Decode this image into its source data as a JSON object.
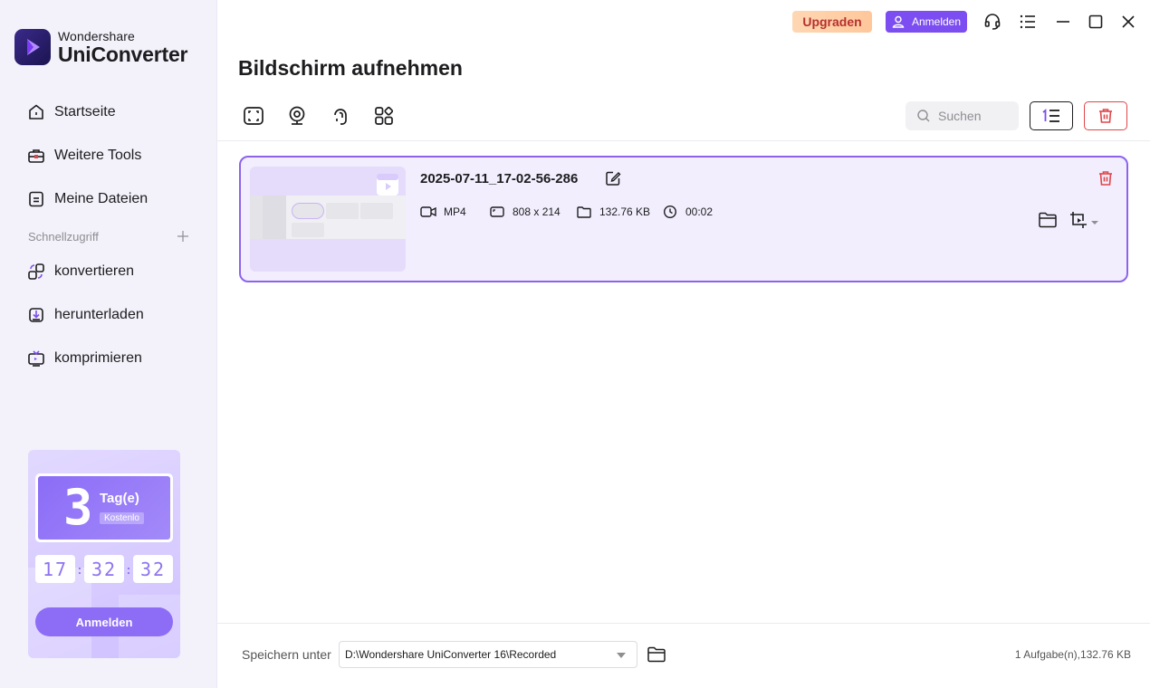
{
  "app": {
    "brand_line1": "Wondershare",
    "brand_line2": "UniConverter"
  },
  "sidebar": {
    "items": [
      {
        "label": "Startseite",
        "icon": "home-icon"
      },
      {
        "label": "Weitere Tools",
        "icon": "toolbox-icon"
      },
      {
        "label": "Meine Dateien",
        "icon": "files-icon"
      }
    ],
    "quick_access_title": "Schnellzugriff",
    "quick_items": [
      {
        "label": "konvertieren",
        "icon": "convert-icon"
      },
      {
        "label": "herunterladen",
        "icon": "download-icon"
      },
      {
        "label": "komprimieren",
        "icon": "compress-icon"
      }
    ]
  },
  "promo": {
    "days": "3",
    "days_label": "Tag(e)",
    "tag": "Kostenlo",
    "timer": {
      "hours": "17",
      "minutes": "32",
      "seconds": "32"
    },
    "button": "Anmelden"
  },
  "topbar": {
    "upgrade": "Upgraden",
    "login": "Anmelden"
  },
  "page": {
    "title": "Bildschirm aufnehmen",
    "search_placeholder": "Suchen"
  },
  "recording": {
    "filename": "2025-07-11_17-02-56-286",
    "format": "MP4",
    "resolution": "808 x 214",
    "size": "132.76 KB",
    "duration": "00:02"
  },
  "footer": {
    "save_label": "Speichern unter",
    "path": "D:\\Wondershare UniConverter 16\\Recorded",
    "info": "1 Aufgabe(n),132.76 KB"
  },
  "colors": {
    "accent": "#7c4df0",
    "sidebar_bg": "#f3f1fa",
    "card_border": "#8d63ec",
    "card_bg": "#f2eefd",
    "danger": "#e0464a"
  }
}
